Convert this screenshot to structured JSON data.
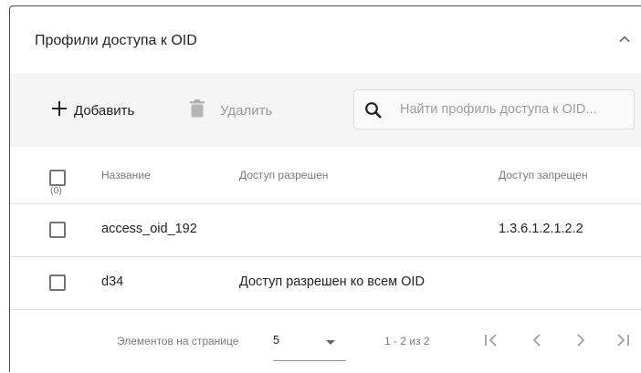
{
  "card": {
    "title": "Профили доступа к OID"
  },
  "toolbar": {
    "add_label": "Добавить",
    "delete_label": "Удалить",
    "search_placeholder": "Найти профиль доступа к OID..."
  },
  "table": {
    "headers": {
      "name": "Название",
      "allowed": "Доступ разрешен",
      "denied": "Доступ запрещен"
    },
    "selected_count": "(0)",
    "rows": [
      {
        "name": "access_oid_192",
        "allowed": "",
        "denied": "1.3.6.1.2.1.2.2"
      },
      {
        "name": "d34",
        "allowed": "Доступ разрешен ко всем OID",
        "denied": ""
      }
    ]
  },
  "paginator": {
    "items_per_page_label": "Элементов на странице",
    "page_size": "5",
    "range_label": "1 - 2 из 2"
  },
  "icons": {
    "collapse": "chevron-up-icon",
    "add": "plus-icon",
    "delete": "trash-icon",
    "search": "search-icon",
    "dropdown": "dropdown-arrow-icon",
    "first_page": "first-page-icon",
    "prev_page": "chevron-left-icon",
    "next_page": "chevron-right-icon",
    "last_page": "last-page-icon"
  }
}
